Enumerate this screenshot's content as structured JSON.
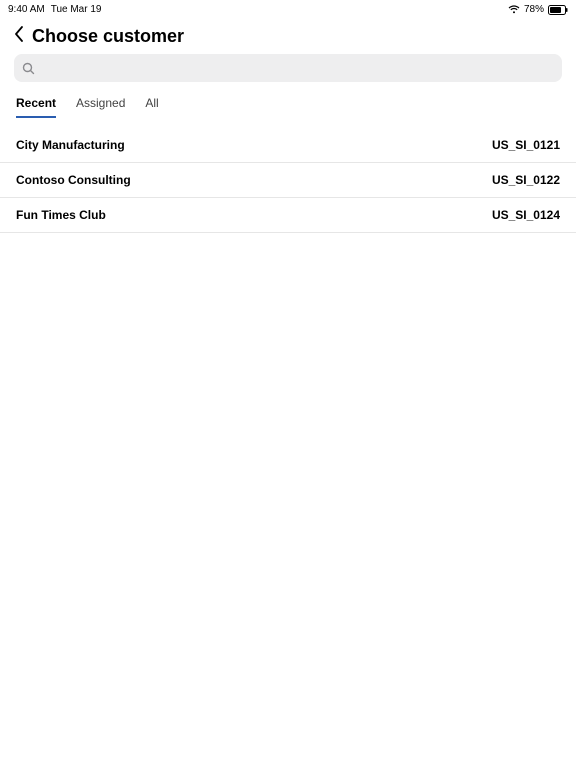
{
  "status": {
    "time": "9:40 AM",
    "date": "Tue Mar 19",
    "battery_pct": "78%"
  },
  "header": {
    "title": "Choose customer"
  },
  "search": {
    "placeholder": "",
    "value": ""
  },
  "tabs": {
    "items": [
      {
        "label": "Recent",
        "active": true
      },
      {
        "label": "Assigned",
        "active": false
      },
      {
        "label": "All",
        "active": false
      }
    ]
  },
  "customers": [
    {
      "name": "City Manufacturing",
      "code": "US_SI_0121"
    },
    {
      "name": "Contoso Consulting",
      "code": "US_SI_0122"
    },
    {
      "name": "Fun Times Club",
      "code": "US_SI_0124"
    }
  ]
}
